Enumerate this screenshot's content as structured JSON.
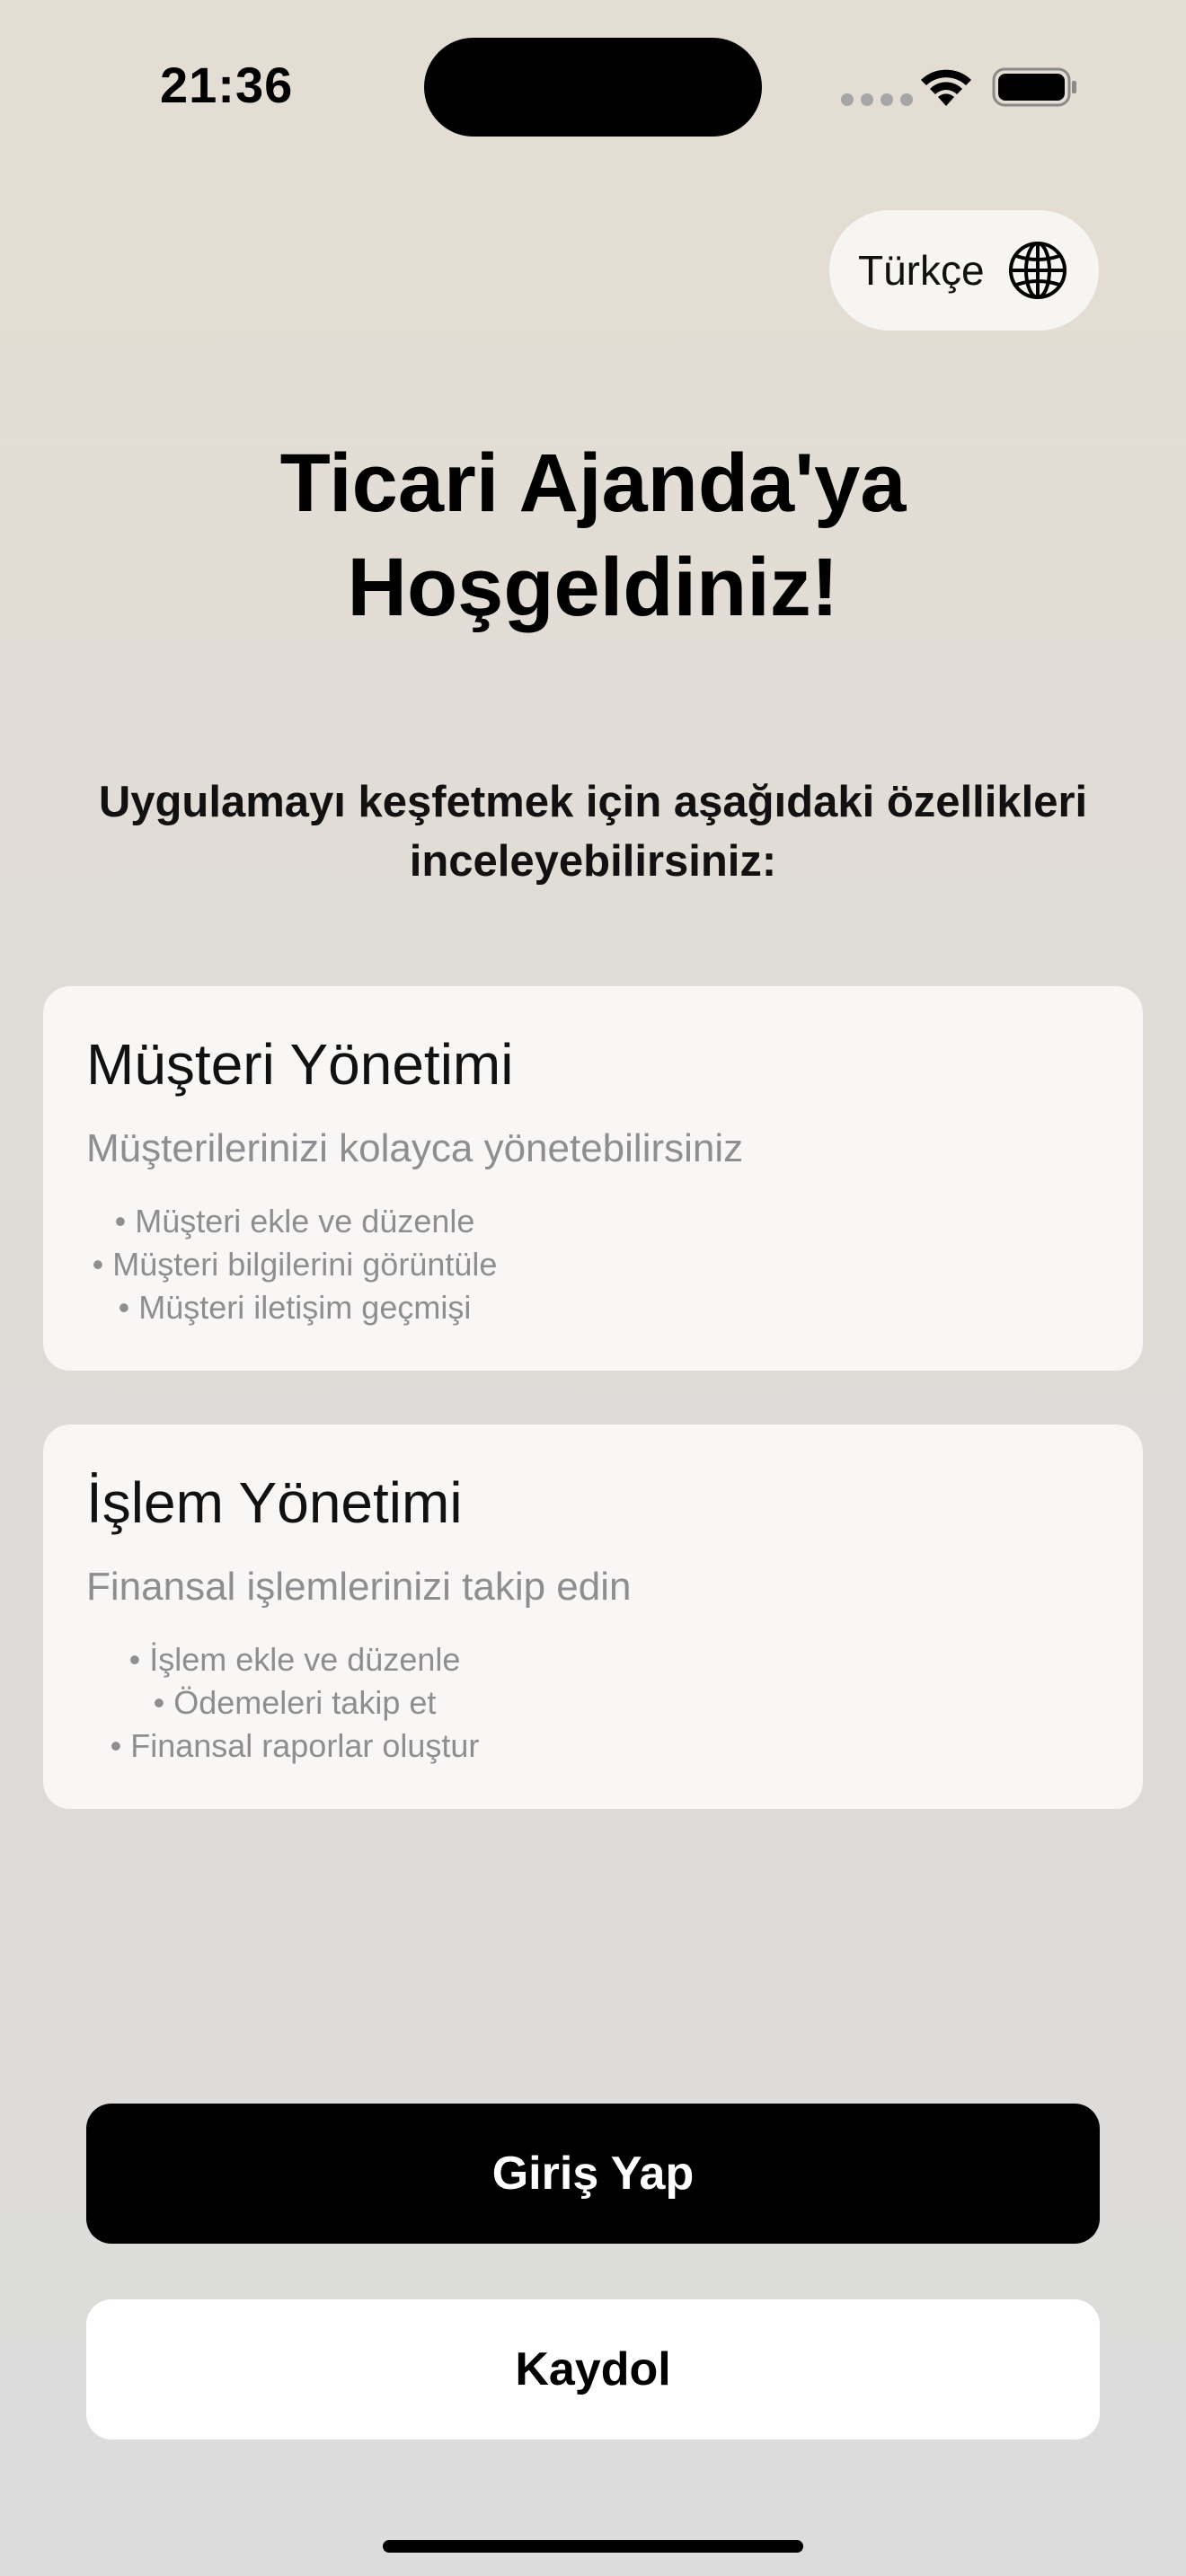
{
  "status_bar": {
    "time": "21:36",
    "wifi_icon": "wifi-icon",
    "battery_icon": "battery-icon"
  },
  "language": {
    "label": "Türkçe",
    "icon": "globe-icon"
  },
  "welcome": {
    "title_line1": "Ticari Ajanda'ya",
    "title_line2": "Hoşgeldiniz!",
    "subtitle_line1": "Uygulamayı keşfetmek için aşağıdaki özellikleri",
    "subtitle_line2": "inceleyebilirsiniz:"
  },
  "features": [
    {
      "title": "Müşteri Yönetimi",
      "description": "Müşterilerinizi kolayca yönetebilirsiniz",
      "bullets": [
        "Müşteri ekle ve düzenle",
        "Müşteri bilgilerini görüntüle",
        "Müşteri iletişim geçmişi"
      ]
    },
    {
      "title": "İşlem Yönetimi",
      "description": "Finansal işlemlerinizi takip edin",
      "bullets": [
        "İşlem ekle ve düzenle",
        "Ödemeleri takip et",
        "Finansal raporlar oluştur"
      ]
    }
  ],
  "buttons": {
    "login_label": "Giriş Yap",
    "signup_label": "Kaydol"
  },
  "colors": {
    "primary_button_bg": "#000000",
    "primary_button_text": "#ffffff",
    "secondary_button_bg": "#ffffff",
    "card_bg": "#f8f7f5",
    "muted_text": "#8e8e92"
  }
}
